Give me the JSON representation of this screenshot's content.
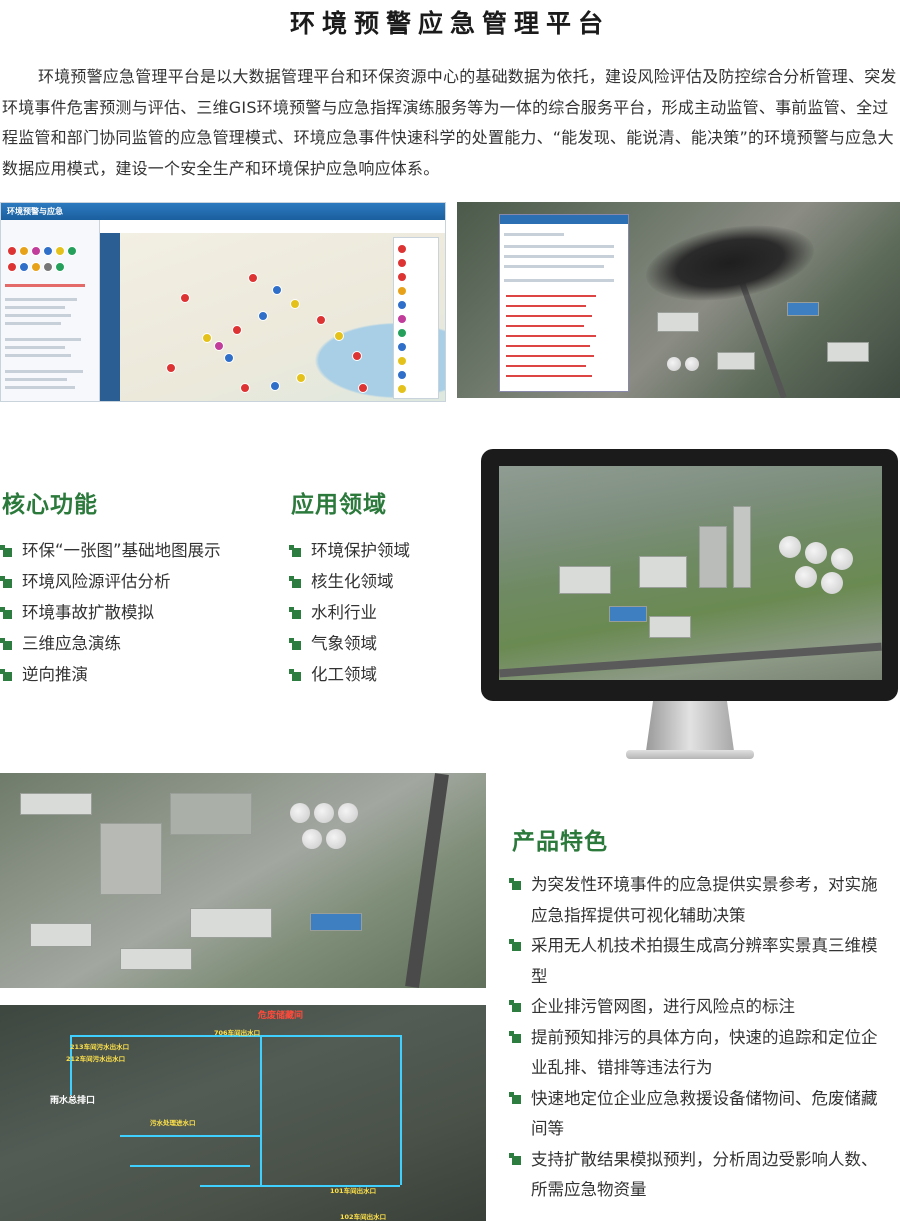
{
  "title": "环境预警应急管理平台",
  "intro": "环境预警应急管理平台是以大数据管理平台和环保资源中心的基础数据为依托，建设风险评估及防控综合分析管理、突发环境事件危害预测与评估、三维GIS环境预警与应急指挥演练服务等为一体的综合服务平台，形成主动监管、事前监管、全过程监管和部门协同监管的应急管理模式、环境应急事件快速科学的处置能力、“能发现、能说清、能决策”的环境预警与应急大数据应用模式，建设一个安全生产和环境保护应急响应体系。",
  "map_screenshot": {
    "app_name": "环境预警与应急"
  },
  "core": {
    "heading": "核心功能",
    "items": [
      "环保“一张图”基础地图展示",
      "环境风险源评估分析",
      "环境事故扩散模拟",
      "三维应急演练",
      "逆向推演"
    ]
  },
  "application": {
    "heading": "应用领域",
    "items": [
      "环境保护领域",
      "核生化领域",
      "水利行业",
      "气象领域",
      "化工领域"
    ]
  },
  "features": {
    "heading": "产品特色",
    "items": [
      "为突发性环境事件的应急提供实景参考，对实施应急指挥提供可视化辅助决策",
      "采用无人机技术拍摄生成高分辨率实景真三维模型",
      "企业排污管网图，进行风险点的标注",
      "提前预知排污的具体方向，快速的追踪和定位企业乱排、错排等违法行为",
      "快速地定位企业应急救援设备储物间、危废储藏间等",
      "支持扩散结果模拟预判，分析周边受影响人数、所需应急物资量"
    ]
  },
  "pipe_labels": {
    "danger_store": "危废储藏间",
    "rain_outlet": "雨水总排口",
    "l1": "706车间出水口",
    "l2": "213车间污水出水口",
    "l3": "212车间污水出水口",
    "l4": "101车间出水口",
    "l5": "102车间出水口",
    "l6": "污水处理进水口"
  },
  "colors": {
    "heading_green": "#2b7a3c",
    "bullet_green": "#2c7d3f",
    "app_header_blue": "#2d7ac0"
  }
}
